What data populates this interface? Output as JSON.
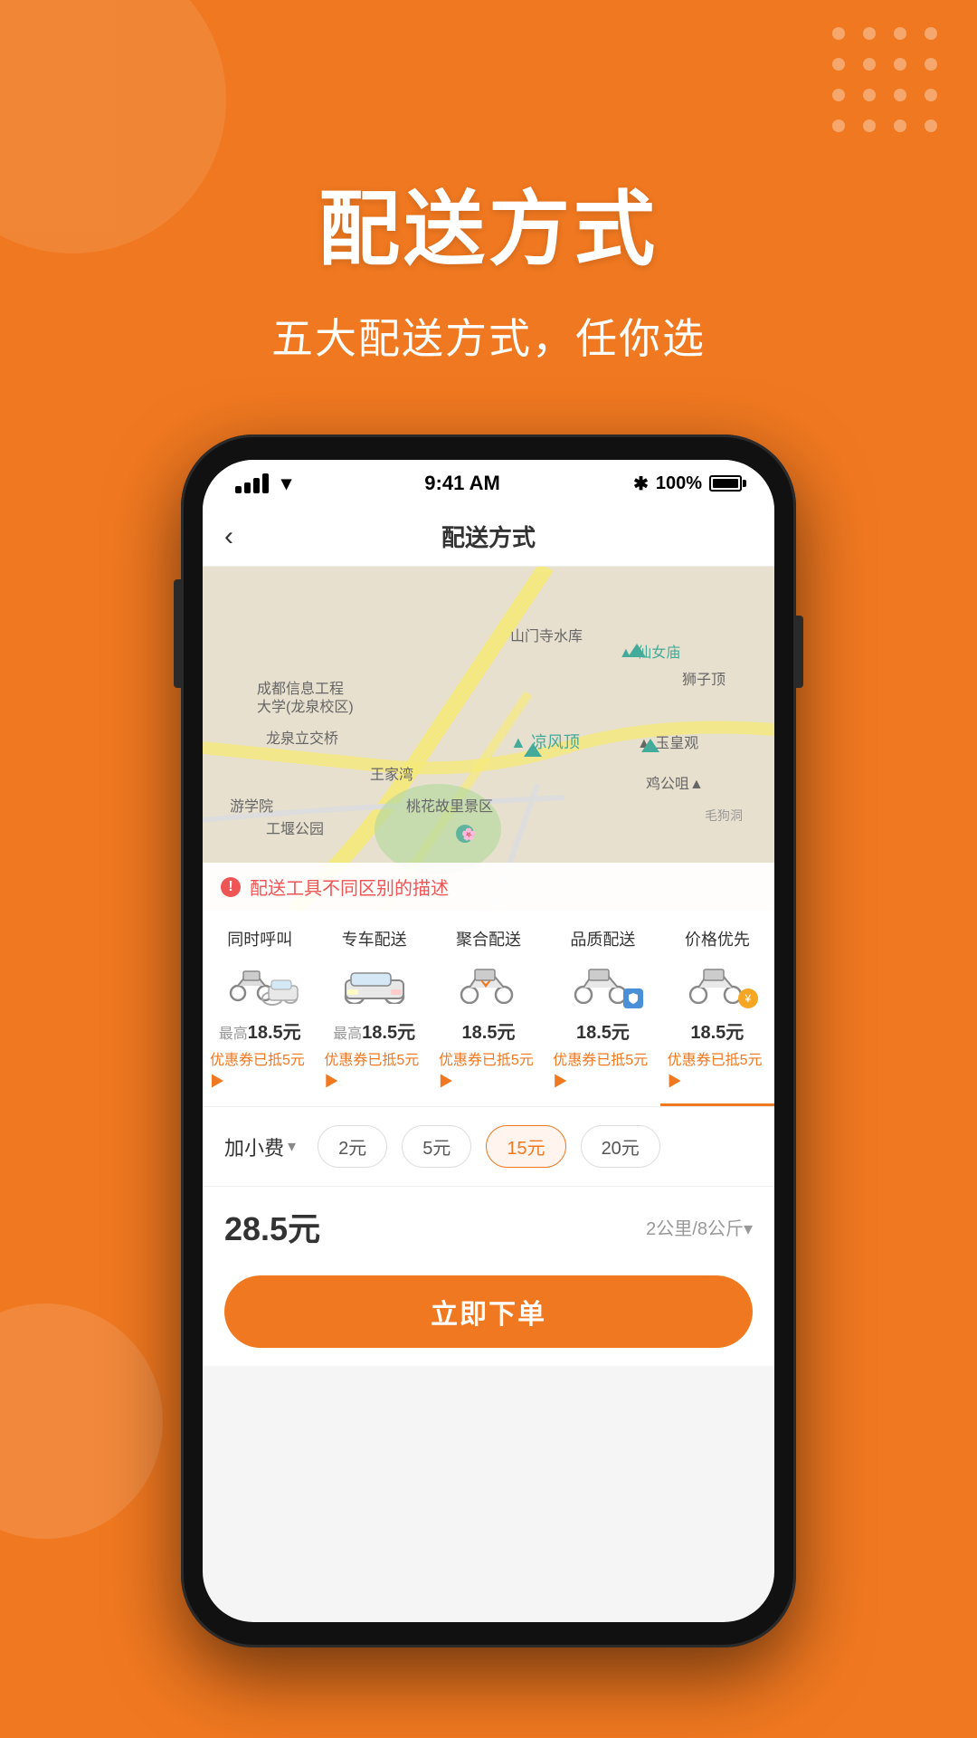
{
  "background_color": "#F07820",
  "decorative": {
    "dots_count": 16
  },
  "hero": {
    "title": "配送方式",
    "subtitle": "五大配送方式，任你选"
  },
  "phone": {
    "status_bar": {
      "time": "9:41 AM",
      "battery": "100%",
      "bluetooth": "⁎"
    },
    "app_header": {
      "back_label": "‹",
      "title": "配送方式"
    },
    "map": {
      "warning_text": "配送工具不同区别的描述"
    },
    "delivery_options": [
      {
        "name": "同时呼叫",
        "price_prefix": "最高",
        "price": "18.5元",
        "coupon": "优惠券已抵5元▶",
        "type": "combo",
        "selected": false
      },
      {
        "name": "专车配送",
        "price_prefix": "最高",
        "price": "18.5元",
        "coupon": "优惠券已抵5元▶",
        "type": "car",
        "selected": false
      },
      {
        "name": "聚合配送",
        "price_prefix": "",
        "price": "18.5元",
        "coupon": "优惠券已抵5元▶",
        "type": "moto",
        "selected": false
      },
      {
        "name": "品质配送",
        "price_prefix": "",
        "price": "18.5元",
        "coupon": "优惠券已抵5元▶",
        "type": "moto_shield",
        "selected": false
      },
      {
        "name": "价格优先",
        "price_prefix": "",
        "price": "18.5元",
        "coupon": "优惠券已抵5元▶",
        "type": "moto_gold",
        "selected": true
      }
    ],
    "extra_fee": {
      "label": "加小费",
      "options": [
        "2元",
        "5元",
        "15元",
        "20元"
      ],
      "selected": "15元"
    },
    "total": {
      "price": "28.5元",
      "note": "2公里/8公斤▾"
    },
    "order_button": "立即下单"
  }
}
